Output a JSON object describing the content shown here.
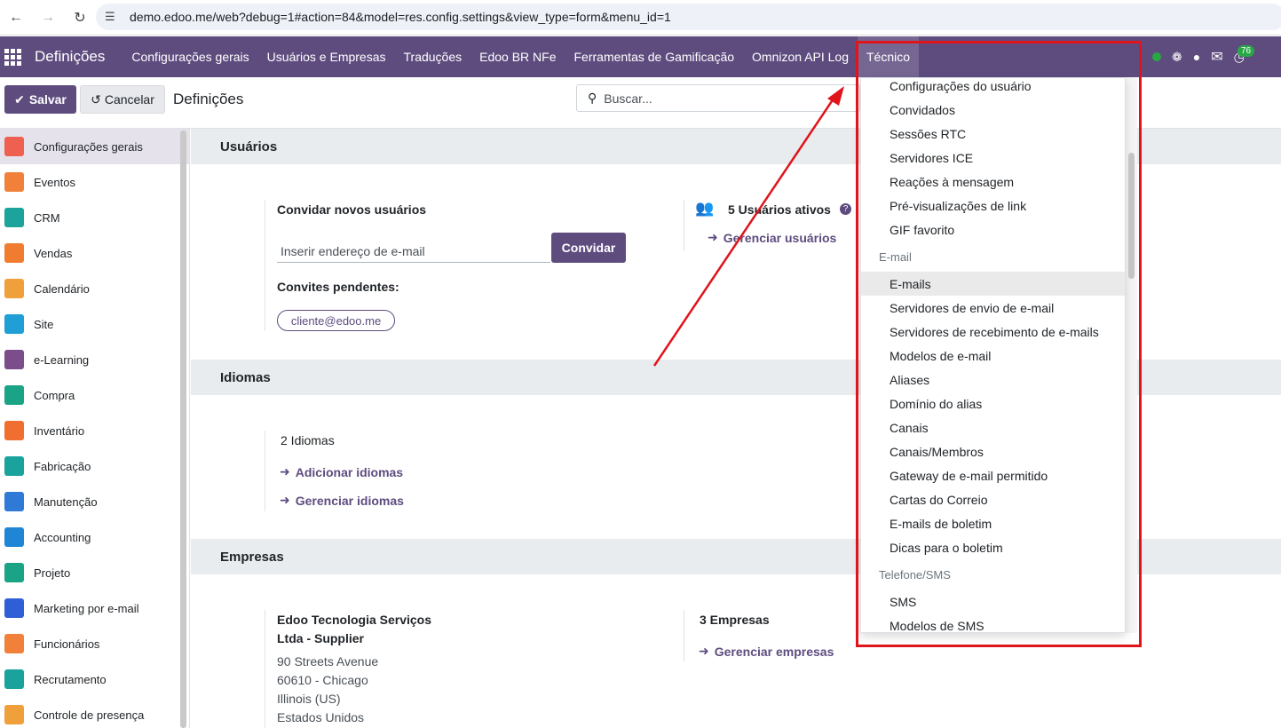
{
  "browser": {
    "url": "demo.edoo.me/web?debug=1#action=84&model=res.config.settings&view_type=form&menu_id=1"
  },
  "navbar": {
    "brand": "Definições",
    "menus": [
      "Configurações gerais",
      "Usuários e Empresas",
      "Traduções",
      "Edoo BR NFe",
      "Ferramentas de Gamificação",
      "Omnizon API Log",
      "Técnico"
    ],
    "active_menu": "Técnico",
    "badge_count": "76"
  },
  "controlpanel": {
    "save_label": "Salvar",
    "cancel_label": "Cancelar",
    "title": "Definições",
    "search_placeholder": "Buscar..."
  },
  "sidebar": {
    "items": [
      {
        "label": "Configurações gerais",
        "icon": "settings-app-icon",
        "color": "#f06050"
      },
      {
        "label": "Eventos",
        "icon": "events-app-icon",
        "color": "#f0803a"
      },
      {
        "label": "CRM",
        "icon": "crm-app-icon",
        "color": "#1ba39c"
      },
      {
        "label": "Vendas",
        "icon": "sales-app-icon",
        "color": "#f07d2f"
      },
      {
        "label": "Calendário",
        "icon": "calendar-app-icon",
        "color": "#f0a03a"
      },
      {
        "label": "Site",
        "icon": "website-app-icon",
        "color": "#1f9fd6"
      },
      {
        "label": "e-Learning",
        "icon": "elearning-app-icon",
        "color": "#7b4d8a"
      },
      {
        "label": "Compra",
        "icon": "purchase-app-icon",
        "color": "#1aa385"
      },
      {
        "label": "Inventário",
        "icon": "inventory-app-icon",
        "color": "#f06e2f"
      },
      {
        "label": "Fabricação",
        "icon": "manufacturing-app-icon",
        "color": "#1aa39c"
      },
      {
        "label": "Manutenção",
        "icon": "maintenance-app-icon",
        "color": "#2f7ad6"
      },
      {
        "label": "Accounting",
        "icon": "accounting-app-icon",
        "color": "#1f86d6"
      },
      {
        "label": "Projeto",
        "icon": "project-app-icon",
        "color": "#1aa385"
      },
      {
        "label": "Marketing por e-mail",
        "icon": "email-marketing-app-icon",
        "color": "#2f5fd6"
      },
      {
        "label": "Funcionários",
        "icon": "employees-app-icon",
        "color": "#f0803a"
      },
      {
        "label": "Recrutamento",
        "icon": "recruitment-app-icon",
        "color": "#1aa39c"
      },
      {
        "label": "Controle de presença",
        "icon": "attendance-app-icon",
        "color": "#f0a03a"
      }
    ]
  },
  "main": {
    "users": {
      "title": "Usuários",
      "invite_label": "Convidar novos usuários",
      "email_placeholder": "Inserir endereço de e-mail",
      "invite_button": "Convidar",
      "pending_label": "Convites pendentes:",
      "pending_email": "cliente@edoo.me",
      "active_users": "5 Usuários ativos",
      "manage_users": "Gerenciar usuários"
    },
    "languages": {
      "title": "Idiomas",
      "count": "2 Idiomas",
      "add": "Adicionar idiomas",
      "manage": "Gerenciar idiomas"
    },
    "companies": {
      "title": "Empresas",
      "company_name_1": "Edoo Tecnologia Serviços",
      "company_name_2": "Ltda - Supplier",
      "address": [
        "90 Streets Avenue",
        "60610 - Chicago",
        "Illinois (US)",
        "Estados Unidos"
      ],
      "count": "3 Empresas",
      "manage": "Gerenciar empresas"
    }
  },
  "dropdown": {
    "group1_items": [
      "Configurações do usuário",
      "Convidados",
      "Sessões RTC",
      "Servidores ICE",
      "Reações à mensagem",
      "Pré-visualizações de link",
      "GIF favorito"
    ],
    "email_header": "E-mail",
    "email_items": [
      "E-mails",
      "Servidores de envio de e-mail",
      "Servidores de recebimento de e-mails",
      "Modelos de e-mail",
      "Aliases",
      "Domínio do alias",
      "Canais",
      "Canais/Membros",
      "Gateway de e-mail permitido",
      "Cartas do Correio",
      "E-mails de boletim",
      "Dicas para o boletim"
    ],
    "sms_header": "Telefone/SMS",
    "sms_items": [
      "SMS",
      "Modelos de SMS"
    ],
    "hovered": "E-mails"
  },
  "annotation": {
    "color": "#e0141b"
  }
}
